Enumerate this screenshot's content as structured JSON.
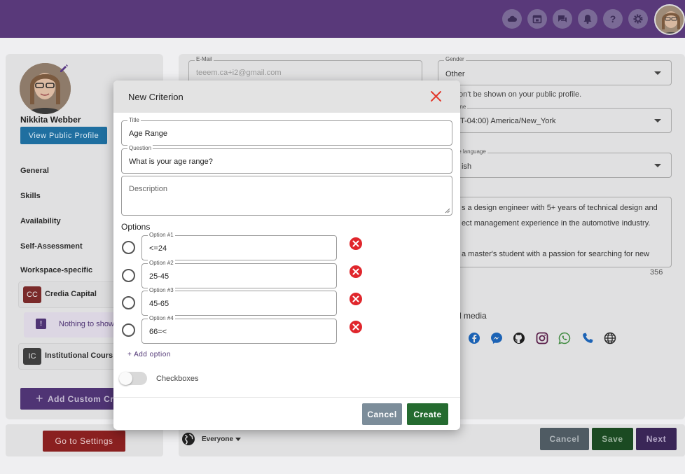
{
  "topbar": {
    "icons": [
      "cloud-icon",
      "calendar-icon",
      "chat-icon",
      "bell-icon",
      "help-icon",
      "gear-icon"
    ],
    "help_glyph": "?"
  },
  "profile": {
    "name": "Nikkita Webber",
    "view_profile_label": "View Public Profile"
  },
  "nav": {
    "items": [
      "General",
      "Skills",
      "Availability",
      "Self-Assessment",
      "Workspace-specific"
    ]
  },
  "workspaces": [
    {
      "badge": "CC",
      "label": "Credia Capital",
      "badge_color": "#7a2a2a"
    },
    {
      "badge": "IC",
      "label": "Institutional Cours",
      "badge_color": "#3e3e3e"
    }
  ],
  "workspace_empty": {
    "glyph": "!",
    "text": "Nothing to show"
  },
  "add_custom_label": "Add Custom Cr",
  "settings_label": "Go to Settings",
  "form": {
    "email_label": "E-Mail",
    "email_value": "teeem.ca+i2@gmail.com",
    "gender_label": "Gender",
    "gender_value": "Other",
    "gender_note": "on't be shown on your public profile.",
    "timezone_label": "one",
    "timezone_value": "T-04:00) America/New_York",
    "language_label": "te language",
    "language_value": "ish",
    "bio_line1": "s a design engineer with 5+ years of technical design and",
    "bio_line2": "ect management experience in the automotive industry.",
    "bio_line3": "a master's student with a passion for searching for new",
    "bio_count": "356",
    "social_label": "l media",
    "social_icons": [
      "facebook-icon",
      "messenger-icon",
      "github-icon",
      "instagram-icon",
      "whatsapp-icon",
      "phone-icon",
      "globe-icon"
    ]
  },
  "bottom_bar": {
    "visibility_label": "Everyone",
    "cancel_label": "Cancel",
    "save_label": "Save",
    "next_label": "Next"
  },
  "modal": {
    "title": "New Criterion",
    "title_field_label": "Title",
    "title_field_value": "Age Range",
    "question_label": "Question",
    "question_value": "What is your age range?",
    "description_placeholder": "Description",
    "options_title": "Options",
    "options": [
      {
        "label": "Option #1",
        "value": "<=24"
      },
      {
        "label": "Option #2",
        "value": "25-45"
      },
      {
        "label": "Option #3",
        "value": "45-65"
      },
      {
        "label": "Option #4",
        "value": "66=<"
      }
    ],
    "add_option_label": "+ Add option",
    "checkboxes_label": "Checkboxes",
    "checkboxes_enabled": false,
    "cancel_label": "Cancel",
    "create_label": "Create"
  }
}
